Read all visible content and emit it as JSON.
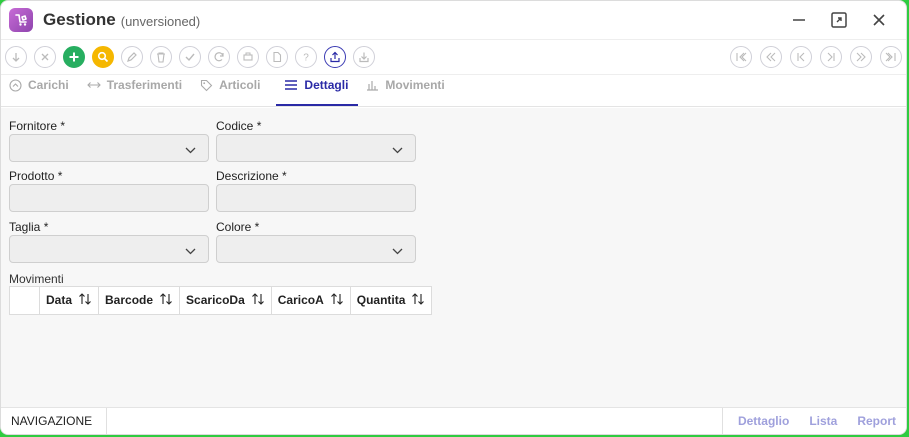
{
  "window": {
    "title": "Gestione",
    "subtitle": "(unversioned)"
  },
  "toolbar": {
    "left_buttons": [
      "arrow-down-icon",
      "close-icon",
      "add-icon",
      "search-icon",
      "edit-icon",
      "delete-icon",
      "check-icon",
      "refresh-icon",
      "print-icon",
      "document-icon",
      "help-icon",
      "upload-icon",
      "download-icon"
    ],
    "right_buttons": [
      "first-record-icon",
      "rewind-icon",
      "previous-icon",
      "next-icon",
      "fast-forward-icon",
      "last-record-icon"
    ]
  },
  "tabs": [
    {
      "label": "Carichi",
      "icon": "upload-circle-icon",
      "active": false
    },
    {
      "label": "Trasferimenti",
      "icon": "arrows-horizontal-icon",
      "active": false
    },
    {
      "label": "Articoli",
      "icon": "tag-icon",
      "active": false
    },
    {
      "label": "Dettagli",
      "icon": "list-icon",
      "active": true
    },
    {
      "label": "Movimenti",
      "icon": "bar-chart-icon",
      "active": false
    }
  ],
  "form": {
    "fornitore_label": "Fornitore *",
    "codice_label": "Codice *",
    "prodotto_label": "Prodotto *",
    "descrizione_label": "Descrizione *",
    "taglia_label": "Taglia *",
    "colore_label": "Colore *"
  },
  "movimenti": {
    "label": "Movimenti",
    "columns": [
      "Data",
      "Barcode",
      "ScaricoDa",
      "CaricoA",
      "Quantita"
    ]
  },
  "statusbar": {
    "navigation": "NAVIGAZIONE",
    "links": [
      "Dettaglio",
      "Lista",
      "Report"
    ]
  },
  "colors": {
    "accent": "#2a2aa6",
    "add": "#27ae60",
    "search": "#f5b700",
    "frame": "#2ecc40"
  }
}
